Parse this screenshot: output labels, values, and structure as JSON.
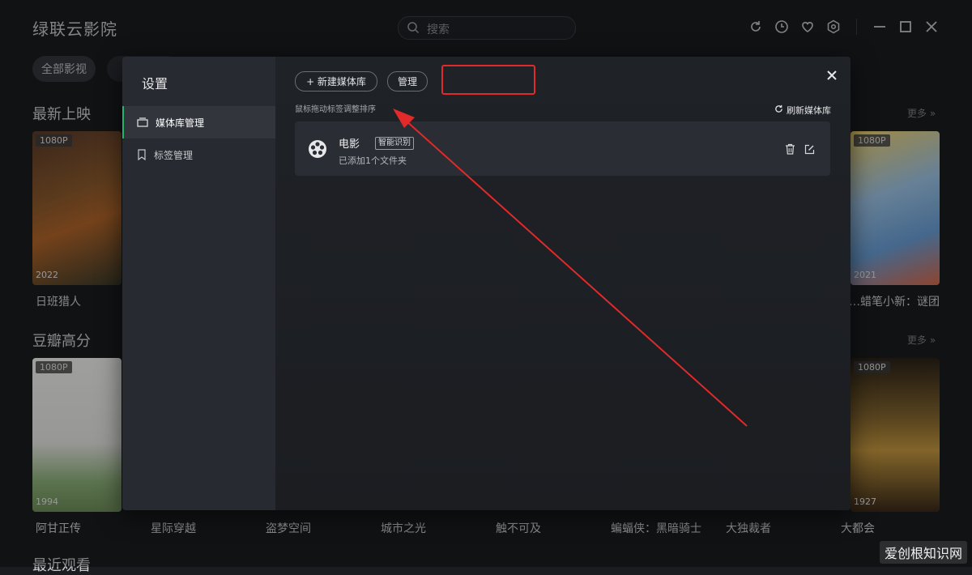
{
  "app": {
    "title": "绿联云影院"
  },
  "search": {
    "placeholder": "搜索"
  },
  "toolbar": {
    "icons": [
      "refresh-icon",
      "history-icon",
      "heart-icon",
      "settings-icon",
      "minimize-icon",
      "maximize-icon",
      "close-icon"
    ]
  },
  "categories": {
    "all": "全部影视"
  },
  "sections": {
    "latest": {
      "title": "最新上映",
      "more": "更多 »"
    },
    "douban": {
      "title": "豆瓣高分",
      "more": "更多 »"
    },
    "recent": {
      "title": "最近观看"
    }
  },
  "latest_movies": [
    {
      "title": "日班猎人",
      "badge": "1080P",
      "year": "2022"
    },
    {
      "title": "蜡笔小新：谜团…",
      "badge": "1080P",
      "year": "2021"
    }
  ],
  "douban_movies": [
    {
      "title": "阿甘正传",
      "badge": "1080P",
      "year": "1994"
    },
    {
      "title": "星际穿越"
    },
    {
      "title": "盗梦空间"
    },
    {
      "title": "城市之光"
    },
    {
      "title": "触不可及"
    },
    {
      "title": "蝙蝠侠：黑暗骑士"
    },
    {
      "title": "大独裁者"
    },
    {
      "title": "大都会",
      "badge": "1080P",
      "year": "1927"
    }
  ],
  "settings": {
    "title": "设置",
    "nav": [
      {
        "label": "媒体库管理",
        "icon": "library-icon"
      },
      {
        "label": "标签管理",
        "icon": "bookmark-icon"
      }
    ],
    "new_library": "+ 新建媒体库",
    "manage": "管理",
    "hint": "鼠标拖动标签调整排序",
    "refresh": "刷新媒体库",
    "libraries": [
      {
        "name": "电影",
        "tag": "智能识别",
        "desc": "已添加1个文件夹"
      }
    ]
  },
  "watermark": "爱创根知识网",
  "colors": {
    "accent": "#27b36b",
    "annotation": "#e22a2a"
  }
}
